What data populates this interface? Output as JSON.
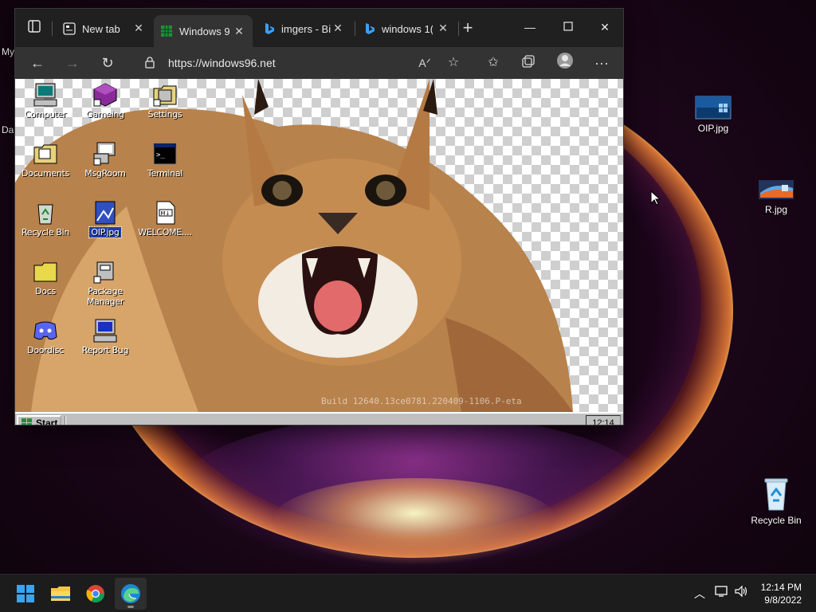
{
  "host_desktop": {
    "icons": [
      {
        "label": "OIP.jpg"
      },
      {
        "label": "R.jpg"
      },
      {
        "label": "Recycle Bin"
      }
    ],
    "partial_labels": [
      "My",
      "Da"
    ]
  },
  "browser": {
    "tabs": [
      {
        "title": "New tab",
        "icon": "newtab-icon"
      },
      {
        "title": "Windows 9",
        "icon": "windows96-icon"
      },
      {
        "title": "imgers - Bi",
        "icon": "bing-icon"
      },
      {
        "title": "windows 1(",
        "icon": "bing-icon"
      }
    ],
    "url": "https://windows96.net"
  },
  "windows96": {
    "icons": [
      {
        "label": "Computer"
      },
      {
        "label": "Gameing"
      },
      {
        "label": "Settings"
      },
      {
        "label": "Documents"
      },
      {
        "label": "MsgRoom"
      },
      {
        "label": "Terminal"
      },
      {
        "label": "Recycle Bin"
      },
      {
        "label": "OIP.jpg"
      },
      {
        "label": "WELCOME...."
      },
      {
        "label": "Docs"
      },
      {
        "label": "Package Manager"
      },
      {
        "label": "Doordisc"
      },
      {
        "label": "Report Bug"
      }
    ],
    "build_text": "Build 12640.13ce0781.220409-1106.P-eta",
    "start_label": "Start",
    "clock": "12:14"
  },
  "taskbar": {
    "time": "12:14 PM",
    "date": "9/8/2022"
  },
  "colors": {
    "w96_face": "#c0c0c0",
    "w96_selection": "#1e3fa8",
    "win11_taskbar": "#1c1c1c",
    "browser_chrome": "#202020"
  }
}
